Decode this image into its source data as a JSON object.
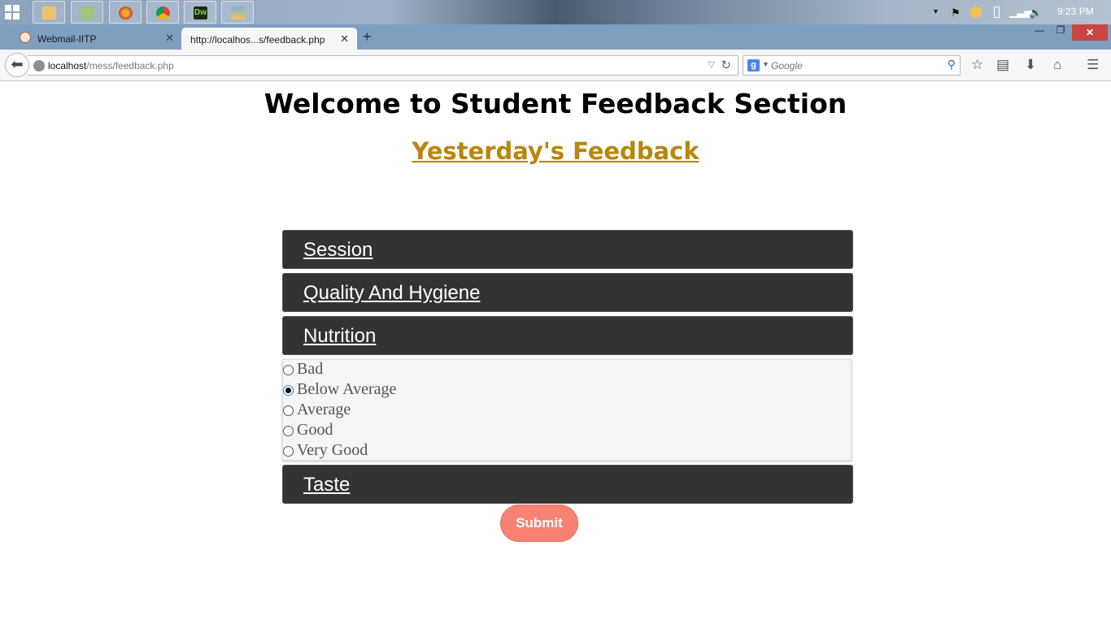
{
  "taskbar": {
    "apps": [
      "file-explorer-icon",
      "photos-icon",
      "firefox-icon",
      "chrome-icon",
      "dreamweaver-icon",
      "paint-icon"
    ],
    "dreamweaver_label": "Dw",
    "clock": "9:23 PM"
  },
  "browser": {
    "tabs": [
      {
        "label": "Webmail-IITP",
        "active": false
      },
      {
        "label": "http://localhos...s/feedback.php",
        "active": true
      }
    ],
    "url_host": "localhost",
    "url_path": "/mess/feedback.php",
    "search_placeholder": "Google",
    "search_engine_letter": "g"
  },
  "page": {
    "title": "Welcome to Student Feedback Section",
    "subtitle": "Yesterday's Feedback",
    "sections": {
      "session": "Session",
      "quality": "Quality And Hygiene",
      "nutrition": "Nutrition",
      "taste": "Taste"
    },
    "nutrition_options": [
      "Bad",
      "Below Average",
      "Average",
      "Good",
      "Very Good"
    ],
    "nutrition_selected": "Below Average",
    "submit_label": "Submit"
  },
  "colors": {
    "accordion_bg": "#333333",
    "subtitle": "#b8860b",
    "submit_bg": "#f88173",
    "tab_strip": "#7f9fc1"
  }
}
